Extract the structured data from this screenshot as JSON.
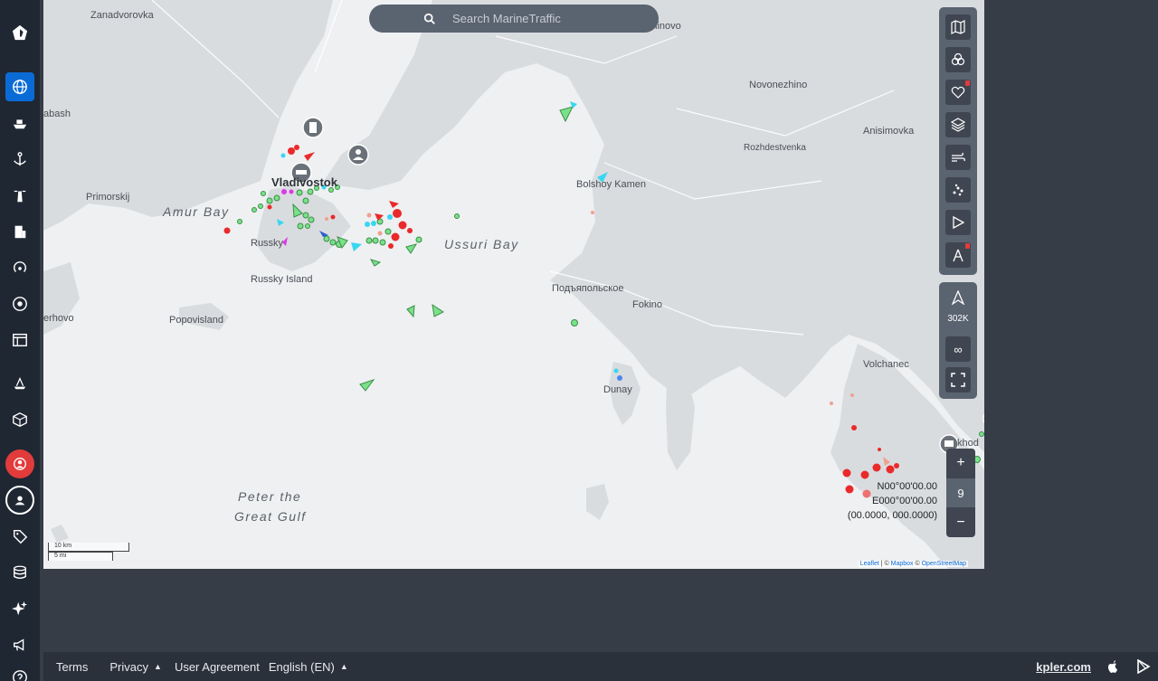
{
  "search": {
    "placeholder": "Search MarineTraffic"
  },
  "places": {
    "zanadvorovka": "Zanadvorovka",
    "smolyaninovo": "molyaninovo",
    "novonezhino": "Novonezhino",
    "anisimovka": "Anisimovka",
    "rozhdestvenka": "Rozhdestvenka",
    "bolshoy_kamen": "Bolshoy Kamen",
    "vladivostok": "Vladivostok",
    "amur_bay": "Amur Bay",
    "ussuri_bay": "Ussuri Bay",
    "primorskij": "Primorskij",
    "russky": "Russky",
    "russky_island": "Russky Island",
    "podyapolskoe": "Подъяпольское",
    "fokino": "Fokino",
    "popovisland": "Popovisland",
    "rhovo": "erhovo",
    "abash": "abash",
    "volchanec": "Volchanec",
    "dunay": "Dunay",
    "peter_gulf_1": "Peter the",
    "peter_gulf_2": "Great Gulf",
    "nakhodka": "khod"
  },
  "toolbar": {
    "vessel_count": "302K",
    "infinite": "∞"
  },
  "zoom": {
    "level": "9",
    "plus": "+",
    "minus": "−"
  },
  "coords": {
    "lat": "N00°00'00.00",
    "lon": "E000°00'00.00",
    "decimal": "(00.0000, 000.0000)"
  },
  "scale": {
    "km": "10 km",
    "mi": "5 mi"
  },
  "attribution": {
    "leaflet": "Leaflet",
    "sep1": " | © ",
    "mapbox": "Mapbox",
    "sep2": " © ",
    "osm": "OpenStreetMap"
  },
  "footer": {
    "terms": "Terms",
    "privacy": "Privacy",
    "user_agreement": "User Agreement",
    "language": "English (EN)",
    "kpler": "kpler.com"
  },
  "colors": {
    "sidebar": "#1f2733",
    "accent": "#0b6bd6",
    "water": "#eef0f2",
    "land": "#d9dcdf",
    "toolbar": "#5a6370"
  }
}
